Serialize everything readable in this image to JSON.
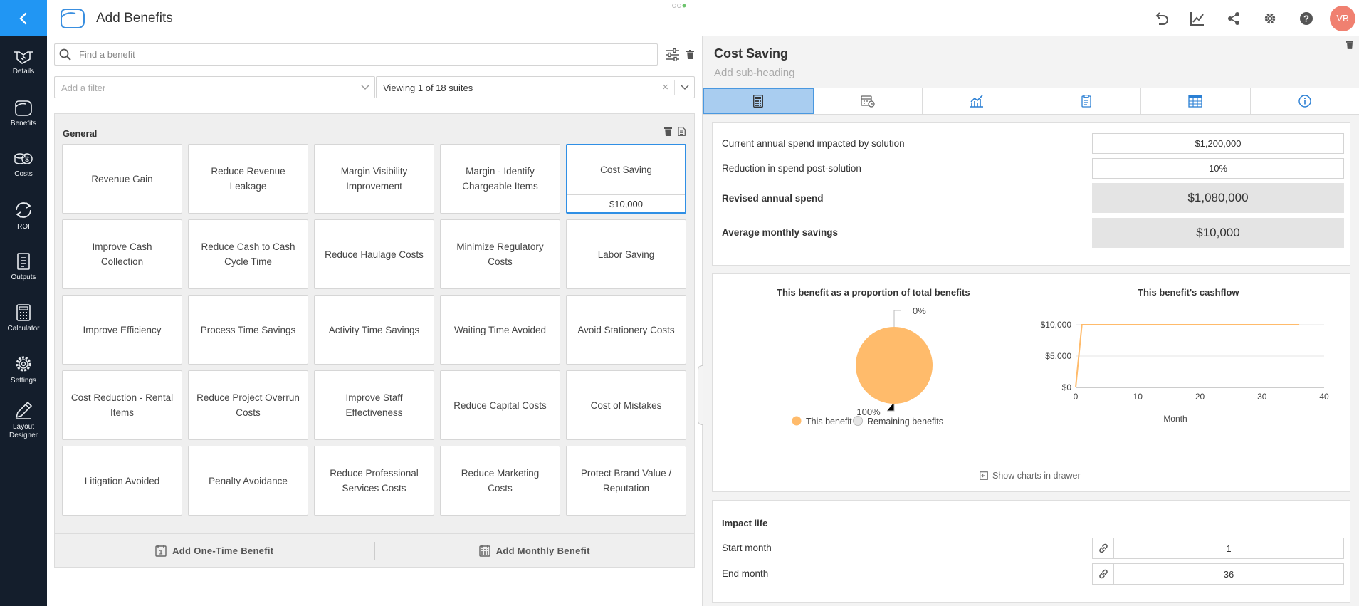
{
  "header": {
    "title": "Add Benefits",
    "avatar_initials": "VB",
    "accent_color": "#2196f3",
    "actions": [
      "undo-icon",
      "chart-edit-icon",
      "share-icon",
      "gear-icon",
      "help-icon"
    ]
  },
  "sidebar": {
    "items": [
      {
        "label": "Details",
        "icon": "handshake-icon"
      },
      {
        "label": "Benefits",
        "icon": "benefits-icon"
      },
      {
        "label": "Costs",
        "icon": "coins-icon"
      },
      {
        "label": "ROI",
        "icon": "roi-cycle-icon"
      },
      {
        "label": "Outputs",
        "icon": "document-icon"
      },
      {
        "label": "Calculator",
        "icon": "calculator-icon"
      },
      {
        "label": "Settings",
        "icon": "gear-icon"
      },
      {
        "label": "Layout\nDesigner",
        "icon": "pen-designer-icon"
      }
    ]
  },
  "left": {
    "search_placeholder": "Find a benefit",
    "filter_placeholder": "Add a filter",
    "suite_text": "Viewing 1 of 18 suites",
    "group": {
      "title": "General",
      "benefits": [
        "Revenue Gain",
        "Reduce Revenue Leakage",
        "Margin Visibility Improvement",
        "Margin - Identify Chargeable Items",
        "Cost Saving",
        "Improve Cash Collection",
        "Reduce Cash to Cash Cycle Time",
        "Reduce Haulage Costs",
        "Minimize Regulatory Costs",
        "Labor Saving",
        "Improve Efficiency",
        "Process Time Savings",
        "Activity Time Savings",
        "Waiting Time Avoided",
        "Avoid Stationery Costs",
        "Cost Reduction - Rental Items",
        "Reduce Project Overrun Costs",
        "Improve Staff Effectiveness",
        "Reduce Capital Costs",
        "Cost of Mistakes",
        "Litigation Avoided",
        "Penalty Avoidance",
        "Reduce Professional Services Costs",
        "Reduce Marketing Costs",
        "Protect Brand Value / Reputation"
      ],
      "selected_index": 4,
      "selected_value": "$10,000"
    },
    "footer": {
      "one_time": "Add One-Time Benefit",
      "monthly": "Add Monthly Benefit"
    }
  },
  "detail": {
    "title": "Cost Saving",
    "subheading_placeholder": "Add sub-heading",
    "tabs": [
      "calculator-tab",
      "schedule-tab",
      "chart-tab",
      "notes-tab",
      "table-tab",
      "info-tab"
    ],
    "calc": {
      "current_label": "Current annual spend impacted by solution",
      "current_value": "$1,200,000",
      "reduction_label": "Reduction in spend post-solution",
      "reduction_value": "10%",
      "revised_label": "Revised annual spend",
      "revised_value": "$1,080,000",
      "avg_label": "Average monthly savings",
      "avg_value": "$10,000"
    },
    "impact": {
      "title": "Impact life",
      "start_label": "Start month",
      "start_value": "1",
      "end_label": "End month",
      "end_value": "36"
    },
    "drawer_link": "Show charts in drawer"
  },
  "chart_data": [
    {
      "type": "pie",
      "title": "This benefit as a proportion of total benefits",
      "categories": [
        "This benefit",
        "Remaining benefits"
      ],
      "values": [
        100,
        0
      ],
      "slice_labels": [
        "100%",
        "0%"
      ],
      "colors": [
        "#ffbb6b",
        "#e6e6e6"
      ],
      "legend": "bottom"
    },
    {
      "type": "line",
      "title": "This benefit's cashflow",
      "xlabel": "Month",
      "ylabel": "",
      "xlim": [
        0,
        40
      ],
      "ylim": [
        0,
        10000
      ],
      "x_ticks": [
        "0",
        "10",
        "20",
        "30",
        "40"
      ],
      "y_ticks": [
        "$0",
        "$5,000",
        "$10,000"
      ],
      "grid": true,
      "color": "#ffbb6b",
      "x": [
        0,
        1,
        36
      ],
      "y": [
        0,
        10000,
        10000
      ]
    }
  ]
}
